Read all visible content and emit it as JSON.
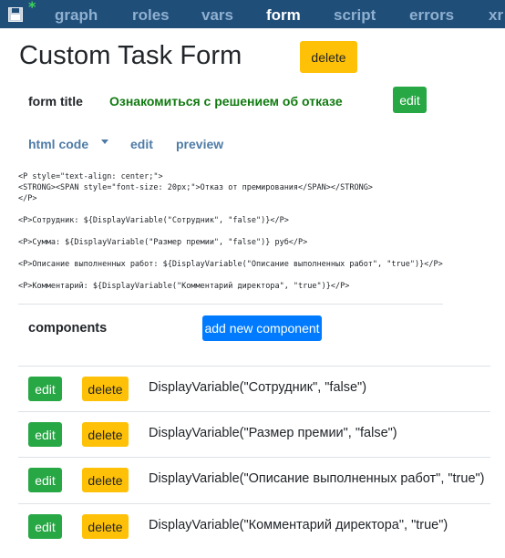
{
  "nav": {
    "items": [
      {
        "label": "graph",
        "active": false
      },
      {
        "label": "roles",
        "active": false
      },
      {
        "label": "vars",
        "active": false
      },
      {
        "label": "form",
        "active": true
      },
      {
        "label": "script",
        "active": false
      },
      {
        "label": "errors",
        "active": false
      },
      {
        "label": "xr",
        "active": false
      }
    ],
    "modified_marker": "*"
  },
  "page": {
    "title": "Custom Task Form",
    "delete_label": "delete"
  },
  "form_title": {
    "label": "form title",
    "value": "Ознакомиться с решением об отказе",
    "edit_label": "edit"
  },
  "html_tabs": {
    "html_code": "html code",
    "edit": "edit",
    "preview": "preview"
  },
  "code_lines": [
    "<P style=\"text-align: center;\">",
    "<STRONG><SPAN style=\"font-size: 20px;\">Отказ от премирования</SPAN></STRONG>",
    "</P>",
    "<P>Сотрудник: ${DisplayVariable(\"Сотрудник\", \"false\")}</P>",
    "<P>Сумма: ${DisplayVariable(\"Размер премии\", \"false\")} руб</P>",
    "<P>Описание выполненных работ: ${DisplayVariable(\"Описание выполненных работ\", \"true\")}</P>",
    "<P>Комментарий: ${DisplayVariable(\"Комментарий директора\", \"true\")}</P>"
  ],
  "components": {
    "label": "components",
    "add_label": "add new component",
    "rows": [
      {
        "edit": "edit",
        "delete": "delete",
        "text": "DisplayVariable(\"Сотрудник\", \"false\")"
      },
      {
        "edit": "edit",
        "delete": "delete",
        "text": "DisplayVariable(\"Размер премии\", \"false\")"
      },
      {
        "edit": "edit",
        "delete": "delete",
        "text": "DisplayVariable(\"Описание выполненных работ\", \"true\")"
      },
      {
        "edit": "edit",
        "delete": "delete",
        "text": "DisplayVariable(\"Комментарий директора\", \"true\")"
      }
    ]
  },
  "colors": {
    "navbar": "#1f4e79",
    "warning": "#ffc107",
    "success": "#28a745",
    "primary": "#007bff",
    "title_value": "#107a10",
    "link": "#4f7ba6"
  }
}
